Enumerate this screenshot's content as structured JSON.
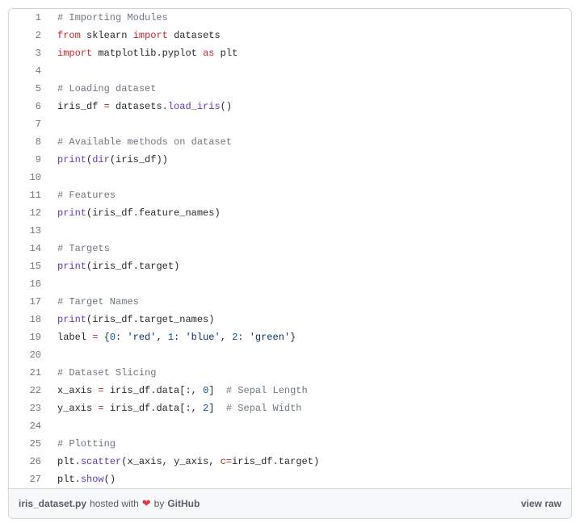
{
  "code": {
    "lines": [
      {
        "n": "1",
        "tokens": [
          {
            "t": "# Importing Modules",
            "c": "pl-c"
          }
        ]
      },
      {
        "n": "2",
        "tokens": [
          {
            "t": "from",
            "c": "pl-k"
          },
          {
            "t": " "
          },
          {
            "t": "sklearn",
            "c": "pl-s1"
          },
          {
            "t": " "
          },
          {
            "t": "import",
            "c": "pl-k"
          },
          {
            "t": " "
          },
          {
            "t": "datasets",
            "c": "pl-s1"
          }
        ]
      },
      {
        "n": "3",
        "tokens": [
          {
            "t": "import",
            "c": "pl-k"
          },
          {
            "t": " "
          },
          {
            "t": "matplotlib",
            "c": "pl-s1"
          },
          {
            "t": "."
          },
          {
            "t": "pyplot",
            "c": "pl-s1"
          },
          {
            "t": " "
          },
          {
            "t": "as",
            "c": "pl-k"
          },
          {
            "t": " "
          },
          {
            "t": "plt",
            "c": "pl-s1"
          }
        ]
      },
      {
        "n": "4",
        "tokens": [
          {
            "t": ""
          }
        ]
      },
      {
        "n": "5",
        "tokens": [
          {
            "t": "# Loading dataset",
            "c": "pl-c"
          }
        ]
      },
      {
        "n": "6",
        "tokens": [
          {
            "t": "iris_df",
            "c": "pl-s1"
          },
          {
            "t": " "
          },
          {
            "t": "=",
            "c": "pl-k"
          },
          {
            "t": " "
          },
          {
            "t": "datasets",
            "c": "pl-s1"
          },
          {
            "t": "."
          },
          {
            "t": "load_iris",
            "c": "pl-en"
          },
          {
            "t": "()"
          }
        ]
      },
      {
        "n": "7",
        "tokens": [
          {
            "t": ""
          }
        ]
      },
      {
        "n": "8",
        "tokens": [
          {
            "t": "# Available methods on dataset",
            "c": "pl-c"
          }
        ]
      },
      {
        "n": "9",
        "tokens": [
          {
            "t": "print",
            "c": "pl-en"
          },
          {
            "t": "("
          },
          {
            "t": "dir",
            "c": "pl-en"
          },
          {
            "t": "("
          },
          {
            "t": "iris_df",
            "c": "pl-s1"
          },
          {
            "t": "))"
          }
        ]
      },
      {
        "n": "10",
        "tokens": [
          {
            "t": ""
          }
        ]
      },
      {
        "n": "11",
        "tokens": [
          {
            "t": "# Features",
            "c": "pl-c"
          }
        ]
      },
      {
        "n": "12",
        "tokens": [
          {
            "t": "print",
            "c": "pl-en"
          },
          {
            "t": "("
          },
          {
            "t": "iris_df",
            "c": "pl-s1"
          },
          {
            "t": "."
          },
          {
            "t": "feature_names",
            "c": "pl-s1"
          },
          {
            "t": ")"
          }
        ]
      },
      {
        "n": "13",
        "tokens": [
          {
            "t": ""
          }
        ]
      },
      {
        "n": "14",
        "tokens": [
          {
            "t": "# Targets",
            "c": "pl-c"
          }
        ]
      },
      {
        "n": "15",
        "tokens": [
          {
            "t": "print",
            "c": "pl-en"
          },
          {
            "t": "("
          },
          {
            "t": "iris_df",
            "c": "pl-s1"
          },
          {
            "t": "."
          },
          {
            "t": "target",
            "c": "pl-s1"
          },
          {
            "t": ")"
          }
        ]
      },
      {
        "n": "16",
        "tokens": [
          {
            "t": ""
          }
        ]
      },
      {
        "n": "17",
        "tokens": [
          {
            "t": "# Target Names",
            "c": "pl-c"
          }
        ]
      },
      {
        "n": "18",
        "tokens": [
          {
            "t": "print",
            "c": "pl-en"
          },
          {
            "t": "("
          },
          {
            "t": "iris_df",
            "c": "pl-s1"
          },
          {
            "t": "."
          },
          {
            "t": "target_names",
            "c": "pl-s1"
          },
          {
            "t": ")"
          }
        ]
      },
      {
        "n": "19",
        "tokens": [
          {
            "t": "label",
            "c": "pl-s1"
          },
          {
            "t": " "
          },
          {
            "t": "=",
            "c": "pl-k"
          },
          {
            "t": " {"
          },
          {
            "t": "0",
            "c": "pl-c1"
          },
          {
            "t": ": "
          },
          {
            "t": "'red'",
            "c": "pl-s"
          },
          {
            "t": ", "
          },
          {
            "t": "1",
            "c": "pl-c1"
          },
          {
            "t": ": "
          },
          {
            "t": "'blue'",
            "c": "pl-s"
          },
          {
            "t": ", "
          },
          {
            "t": "2",
            "c": "pl-c1"
          },
          {
            "t": ": "
          },
          {
            "t": "'green'",
            "c": "pl-s"
          },
          {
            "t": "}"
          }
        ]
      },
      {
        "n": "20",
        "tokens": [
          {
            "t": ""
          }
        ]
      },
      {
        "n": "21",
        "tokens": [
          {
            "t": "# Dataset Slicing",
            "c": "pl-c"
          }
        ]
      },
      {
        "n": "22",
        "tokens": [
          {
            "t": "x_axis",
            "c": "pl-s1"
          },
          {
            "t": " "
          },
          {
            "t": "=",
            "c": "pl-k"
          },
          {
            "t": " "
          },
          {
            "t": "iris_df",
            "c": "pl-s1"
          },
          {
            "t": "."
          },
          {
            "t": "data",
            "c": "pl-s1"
          },
          {
            "t": "[:, "
          },
          {
            "t": "0",
            "c": "pl-c1"
          },
          {
            "t": "]  "
          },
          {
            "t": "# Sepal Length",
            "c": "pl-c"
          }
        ]
      },
      {
        "n": "23",
        "tokens": [
          {
            "t": "y_axis",
            "c": "pl-s1"
          },
          {
            "t": " "
          },
          {
            "t": "=",
            "c": "pl-k"
          },
          {
            "t": " "
          },
          {
            "t": "iris_df",
            "c": "pl-s1"
          },
          {
            "t": "."
          },
          {
            "t": "data",
            "c": "pl-s1"
          },
          {
            "t": "[:, "
          },
          {
            "t": "2",
            "c": "pl-c1"
          },
          {
            "t": "]  "
          },
          {
            "t": "# Sepal Width",
            "c": "pl-c"
          }
        ]
      },
      {
        "n": "24",
        "tokens": [
          {
            "t": ""
          }
        ]
      },
      {
        "n": "25",
        "tokens": [
          {
            "t": "# Plotting",
            "c": "pl-c"
          }
        ]
      },
      {
        "n": "26",
        "tokens": [
          {
            "t": "plt",
            "c": "pl-s1"
          },
          {
            "t": "."
          },
          {
            "t": "scatter",
            "c": "pl-en"
          },
          {
            "t": "("
          },
          {
            "t": "x_axis",
            "c": "pl-s1"
          },
          {
            "t": ", "
          },
          {
            "t": "y_axis",
            "c": "pl-s1"
          },
          {
            "t": ", "
          },
          {
            "t": "c",
            "c": "pl-v"
          },
          {
            "t": "=",
            "c": "pl-k"
          },
          {
            "t": "iris_df",
            "c": "pl-s1"
          },
          {
            "t": "."
          },
          {
            "t": "target",
            "c": "pl-s1"
          },
          {
            "t": ")"
          }
        ]
      },
      {
        "n": "27",
        "tokens": [
          {
            "t": "plt",
            "c": "pl-s1"
          },
          {
            "t": "."
          },
          {
            "t": "show",
            "c": "pl-en"
          },
          {
            "t": "()"
          }
        ]
      }
    ]
  },
  "meta": {
    "filename": "iris_dataset.py",
    "hosted_with": " hosted with ",
    "heart": "❤",
    "by": " by ",
    "github": "GitHub",
    "view_raw": "view raw"
  }
}
